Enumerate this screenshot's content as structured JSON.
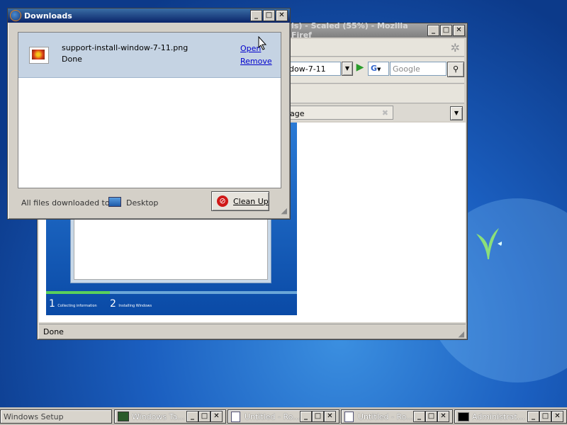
{
  "downloads_window": {
    "title": "Downloads",
    "item": {
      "filename": "support-install-window-7-11.png",
      "status": "Done",
      "open_label": "Open",
      "remove_label": "Remove"
    },
    "footer": {
      "files_to_label": "All files downloaded to:",
      "folder": "Desktop",
      "cleanup_label": "Clean Up"
    }
  },
  "browser_window": {
    "title_fragment": "ls) - Scaled (55%) - Mozilla Firef",
    "address_fragment": "indow-7-11",
    "search_placeholder": "Google",
    "tab_fragment": "page",
    "status": "Done",
    "setup_steps": [
      {
        "num": "1",
        "label": "Collecting information"
      },
      {
        "num": "2",
        "label": "Installing Windows"
      }
    ]
  },
  "taskbar": {
    "items": [
      {
        "label": "Windows Setup"
      },
      {
        "label": "Windows Ta..."
      },
      {
        "label": "Untitled - Ro..."
      },
      {
        "label": "Untitled - Ro..."
      },
      {
        "label": "Administrat..."
      }
    ]
  }
}
